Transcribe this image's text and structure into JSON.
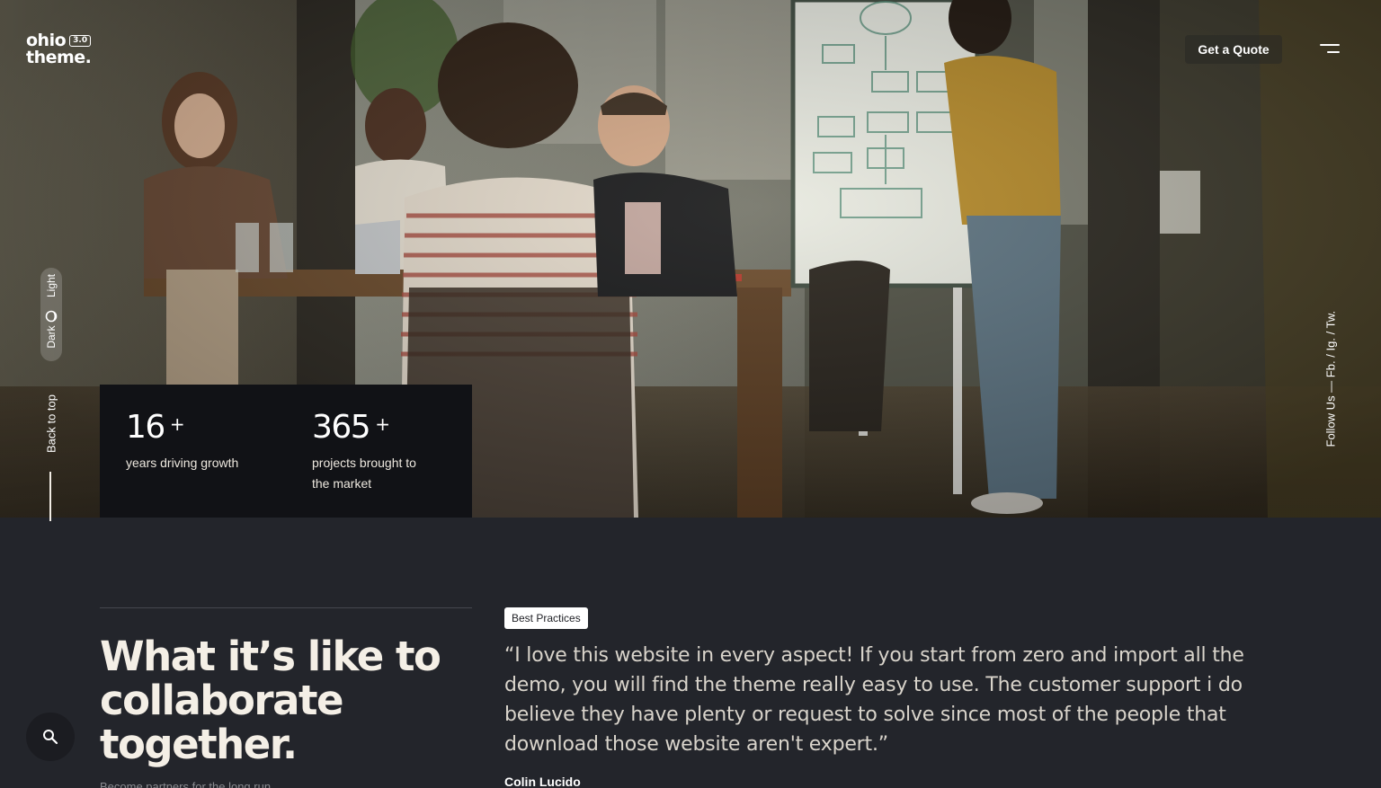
{
  "logo": {
    "name_line1": "ohio",
    "name_line2": "theme.",
    "version": "3.0"
  },
  "header": {
    "cta_label": "Get a Quote",
    "menu_icon": "hamburger-menu-icon"
  },
  "theme_toggle": {
    "light_label": "Light",
    "dark_label": "Dark",
    "icon": "moon-icon"
  },
  "back_to_top": {
    "label": "Back to top"
  },
  "social": {
    "prefix": "Follow Us —",
    "links": [
      "Fb.",
      "Ig.",
      "Tw."
    ],
    "separator": "/"
  },
  "stats": [
    {
      "number": "16",
      "suffix": "+",
      "label": "years driving growth"
    },
    {
      "number": "365",
      "suffix": "+",
      "label": "projects brought to the market"
    }
  ],
  "section": {
    "heading": "What it’s like to collaborate together.",
    "subheading": "Become partners for the long run."
  },
  "testimonial": {
    "tag": "Best Practices",
    "quote": "“I love this website in every aspect! If you start from zero and import all the demo, you will find the theme really easy to use. The customer support i do believe they have plenty or request to solve since most of the people that download those website aren't expert.”",
    "author": "Colin Lucido"
  },
  "search": {
    "icon": "search-icon"
  },
  "colors": {
    "page_bg": "#23252b",
    "stats_bg": "#111216",
    "text": "#f1ece4",
    "badge_bg": "#ffffff"
  }
}
